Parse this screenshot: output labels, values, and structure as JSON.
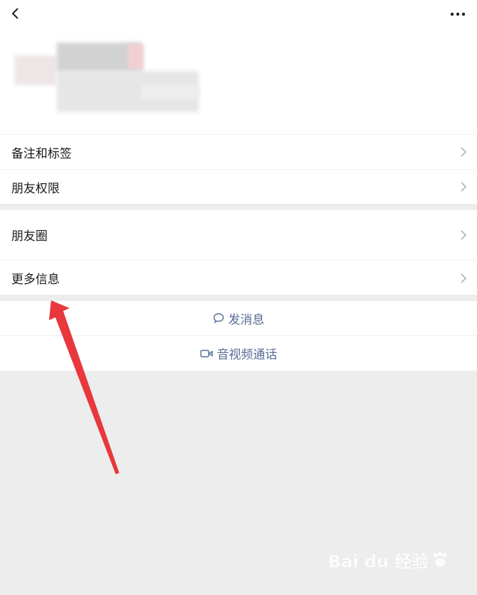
{
  "profile_rows": [
    {
      "label": "备注和标签"
    },
    {
      "label": "朋友权限"
    }
  ],
  "info_rows": [
    {
      "label": "朋友圈"
    },
    {
      "label": "更多信息"
    }
  ],
  "actions": {
    "message_label": "发消息",
    "video_call_label": "音视频通话"
  },
  "watermark": {
    "brand": "Bai du 经验"
  },
  "colors": {
    "link": "#576b95",
    "arrow": "#e8383d",
    "background": "#ededed"
  },
  "icons": [
    "back-arrow-icon",
    "more-dots-icon",
    "chevron-right-icon",
    "chat-bubble-icon",
    "video-camera-icon"
  ]
}
